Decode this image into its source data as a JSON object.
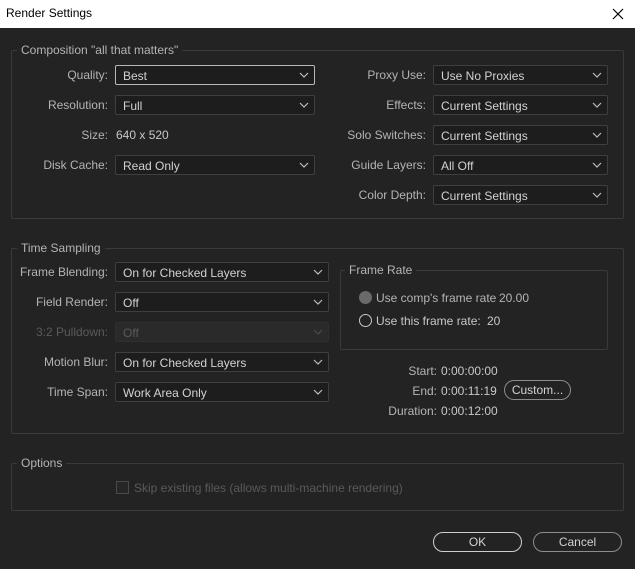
{
  "window": {
    "title": "Render Settings"
  },
  "composition": {
    "group_label": "Composition \"all that matters\"",
    "quality": {
      "label": "Quality:",
      "value": "Best"
    },
    "resolution": {
      "label": "Resolution:",
      "value": "Full"
    },
    "size": {
      "label": "Size:",
      "value": "640 x 520"
    },
    "disk_cache": {
      "label": "Disk Cache:",
      "value": "Read Only"
    },
    "proxy_use": {
      "label": "Proxy Use:",
      "value": "Use No Proxies"
    },
    "effects": {
      "label": "Effects:",
      "value": "Current Settings"
    },
    "solo_switches": {
      "label": "Solo Switches:",
      "value": "Current Settings"
    },
    "guide_layers": {
      "label": "Guide Layers:",
      "value": "All Off"
    },
    "color_depth": {
      "label": "Color Depth:",
      "value": "Current Settings"
    }
  },
  "time_sampling": {
    "group_label": "Time Sampling",
    "frame_blending": {
      "label": "Frame Blending:",
      "value": "On for Checked Layers"
    },
    "field_render": {
      "label": "Field Render:",
      "value": "Off"
    },
    "pulldown": {
      "label": "3:2 Pulldown:",
      "value": "Off"
    },
    "motion_blur": {
      "label": "Motion Blur:",
      "value": "On for Checked Layers"
    },
    "time_span": {
      "label": "Time Span:",
      "value": "Work Area Only"
    },
    "frame_rate": {
      "group_label": "Frame Rate",
      "use_comp_label": "Use comp's frame rate",
      "use_comp_value": "20.00",
      "use_this_label": "Use this frame rate:",
      "use_this_value": "20",
      "selected": "use_this"
    },
    "start": {
      "label": "Start:",
      "value": "0:00:00:00"
    },
    "end": {
      "label": "End:",
      "value": "0:00:11:19"
    },
    "duration": {
      "label": "Duration:",
      "value": "0:00:12:00"
    },
    "custom_button": "Custom..."
  },
  "options": {
    "group_label": "Options",
    "skip_existing_label": "Skip existing files (allows multi-machine rendering)",
    "skip_existing_checked": false
  },
  "buttons": {
    "ok": "OK",
    "cancel": "Cancel"
  },
  "icons": {
    "close": "close-icon",
    "dropdown": "chevron-down-icon"
  },
  "colors": {
    "background": "#232323",
    "titlebar": "#ffffff",
    "field": "#1d1d1d",
    "text": "#c8c8c8",
    "disabled": "#5a5a5a"
  }
}
